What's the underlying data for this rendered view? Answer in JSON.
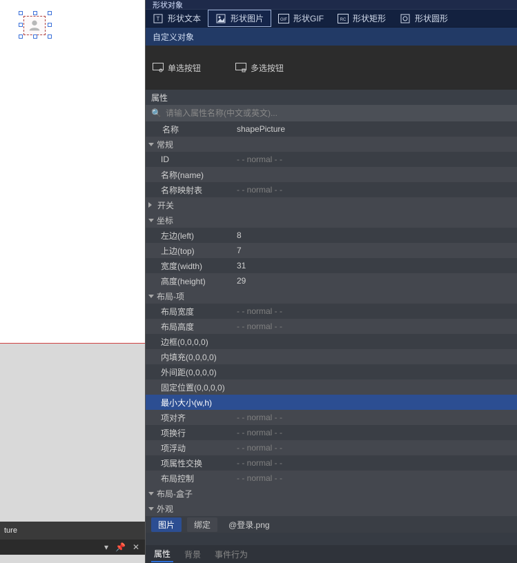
{
  "canvas": {
    "footer_text": "ture"
  },
  "shape_object": {
    "header": "形状对象",
    "items": [
      {
        "label": "形状文本",
        "icon": "text",
        "selected": false
      },
      {
        "label": "形状图片",
        "icon": "image",
        "selected": true
      },
      {
        "label": "形状GIF",
        "icon": "gif",
        "selected": false
      },
      {
        "label": "形状矩形",
        "icon": "rect",
        "selected": false
      },
      {
        "label": "形状圆形",
        "icon": "circle",
        "selected": false
      }
    ]
  },
  "custom_object": {
    "header": "自定义对象",
    "items": [
      {
        "label": "单选按钮",
        "icon": "radio"
      },
      {
        "label": "多选按钮",
        "icon": "check"
      }
    ]
  },
  "properties": {
    "header": "属性",
    "search_placeholder": "请输入属性名称(中文或英文)...",
    "name_label": "名称",
    "name_value": "shapePicture",
    "groups": {
      "general": {
        "label": "常规",
        "expanded": true
      },
      "switch": {
        "label": "开关",
        "expanded": false
      },
      "coord": {
        "label": "坐标",
        "expanded": true
      },
      "layout_item": {
        "label": "布局-项",
        "expanded": true
      },
      "layout_box": {
        "label": "布局-盒子",
        "expanded": true
      },
      "appearance": {
        "label": "外观",
        "expanded": true
      }
    },
    "rows": {
      "id": {
        "label": "ID",
        "value": "- - normal - -"
      },
      "name_en": {
        "label": "名称(name)",
        "value": ""
      },
      "name_map": {
        "label": "名称映射表",
        "value": "- - normal - -"
      },
      "left": {
        "label": "左边(left)",
        "value": "8"
      },
      "top": {
        "label": "上边(top)",
        "value": "7"
      },
      "width": {
        "label": "宽度(width)",
        "value": "31"
      },
      "height": {
        "label": "高度(height)",
        "value": "29"
      },
      "layout_w": {
        "label": "布局宽度",
        "value": "- - normal - -"
      },
      "layout_h": {
        "label": "布局高度",
        "value": "- - normal - -"
      },
      "border": {
        "label": "边框(0,0,0,0)",
        "value": ""
      },
      "padding": {
        "label": "内填充(0,0,0,0)",
        "value": ""
      },
      "margin": {
        "label": "外间距(0,0,0,0)",
        "value": ""
      },
      "fixed": {
        "label": "固定位置(0,0,0,0)",
        "value": ""
      },
      "min_size": {
        "label": "最小大小(w,h)",
        "value": ""
      },
      "align": {
        "label": "项对齐",
        "value": "- - normal - -"
      },
      "wrap": {
        "label": "项换行",
        "value": "- - normal - -"
      },
      "float": {
        "label": "项浮动",
        "value": "- - normal - -"
      },
      "swap": {
        "label": "项属性交换",
        "value": "- - normal - -"
      },
      "layout_ctrl": {
        "label": "布局控制",
        "value": "- - normal - -"
      }
    },
    "image_row": {
      "picture_label": "图片",
      "bind_label": "绑定",
      "value": "@登录.png"
    }
  },
  "bottom_tabs": {
    "items": [
      {
        "label": "属性",
        "active": true
      },
      {
        "label": "背景",
        "active": false
      },
      {
        "label": "事件行为",
        "active": false
      }
    ]
  }
}
